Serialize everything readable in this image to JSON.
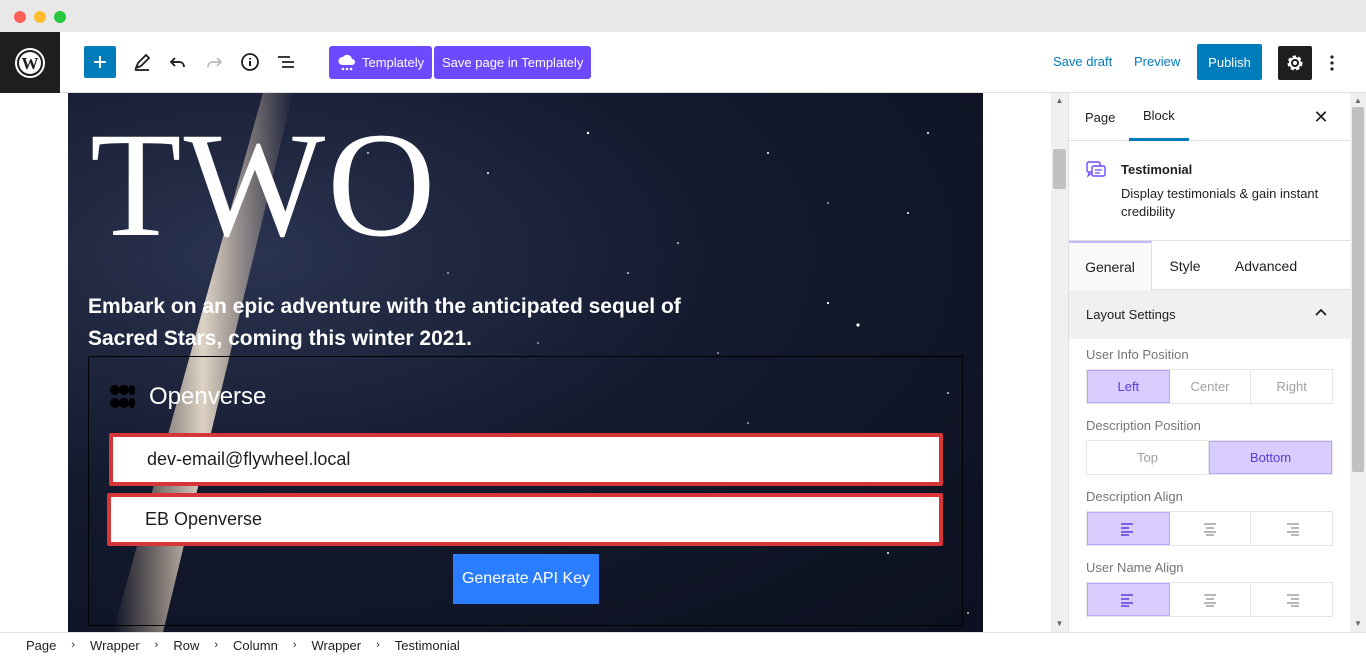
{
  "toolbar": {
    "templately_label": "Templately",
    "save_templately_label": "Save page in Templately",
    "save_draft_label": "Save draft",
    "preview_label": "Preview",
    "publish_label": "Publish"
  },
  "canvas": {
    "hero_title": "TWO",
    "hero_subtitle": "Embark on an epic adventure with the anticipated sequel of Sacred Stars, coming this winter 2021.",
    "brand_name": "Openverse",
    "email_value": "dev-email@flywheel.local",
    "name_value": "EB Openverse",
    "generate_label": "Generate API Key"
  },
  "sidebar": {
    "tabs": [
      {
        "label": "Page",
        "active": false
      },
      {
        "label": "Block",
        "active": true
      }
    ],
    "block": {
      "name": "Testimonial",
      "description": "Display testimonials & gain instant credibility"
    },
    "sub_tabs": [
      {
        "label": "General",
        "active": true
      },
      {
        "label": "Style",
        "active": false
      },
      {
        "label": "Advanced",
        "active": false
      }
    ],
    "panel_title": "Layout Settings",
    "user_info_position": {
      "label": "User Info Position",
      "options": [
        "Left",
        "Center",
        "Right"
      ],
      "selected": "Left"
    },
    "description_position": {
      "label": "Description Position",
      "options": [
        "Top",
        "Bottom"
      ],
      "selected": "Bottom"
    },
    "description_align": {
      "label": "Description Align",
      "icons": [
        "align-left-icon",
        "align-center-icon",
        "align-right-icon"
      ],
      "selected": "align-left-icon"
    },
    "user_name_align": {
      "label": "User Name Align",
      "icons": [
        "align-left-icon",
        "align-center-icon",
        "align-right-icon"
      ],
      "selected": "align-left-icon"
    }
  },
  "breadcrumb": [
    "Page",
    "Wrapper",
    "Row",
    "Column",
    "Wrapper",
    "Testimonial"
  ],
  "colors": {
    "wp_blue": "#007cba",
    "templately_purple": "#6d4aff",
    "field_border_red": "#d63638",
    "generate_blue": "#2b7dff",
    "segment_active": "#d9ccff"
  }
}
